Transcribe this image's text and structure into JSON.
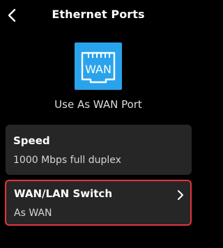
{
  "header": {
    "title": "Ethernet Ports",
    "back_icon": "chevron-left-icon"
  },
  "port": {
    "icon": "ethernet-port-icon",
    "icon_text": "WAN",
    "icon_color": "#29a3ec",
    "caption": "Use As WAN Port"
  },
  "speed_card": {
    "label": "Speed",
    "value": "1000 Mbps full duplex"
  },
  "switch_card": {
    "label": "WAN/LAN Switch",
    "value": "As WAN",
    "chevron_icon": "chevron-right-icon",
    "highlight_color": "#e5353a"
  }
}
